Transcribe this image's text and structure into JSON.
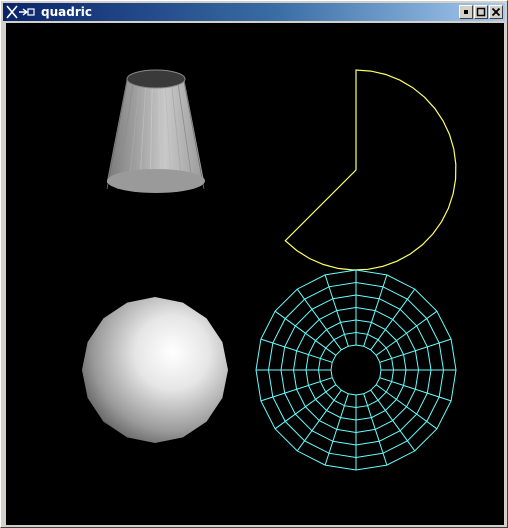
{
  "window": {
    "title": "quadric",
    "buttons": [
      "minimize",
      "maximize",
      "close"
    ]
  },
  "scene": {
    "background": "#000000",
    "objects": [
      {
        "name": "cylinder",
        "style": "smooth-shaded",
        "color": "#ffffff"
      },
      {
        "name": "partial-disk",
        "style": "outline",
        "color": "#ffff66"
      },
      {
        "name": "sphere",
        "style": "smooth-shaded",
        "color": "#ffffff"
      },
      {
        "name": "disk",
        "style": "wireframe",
        "color": "#66ffff"
      }
    ]
  }
}
